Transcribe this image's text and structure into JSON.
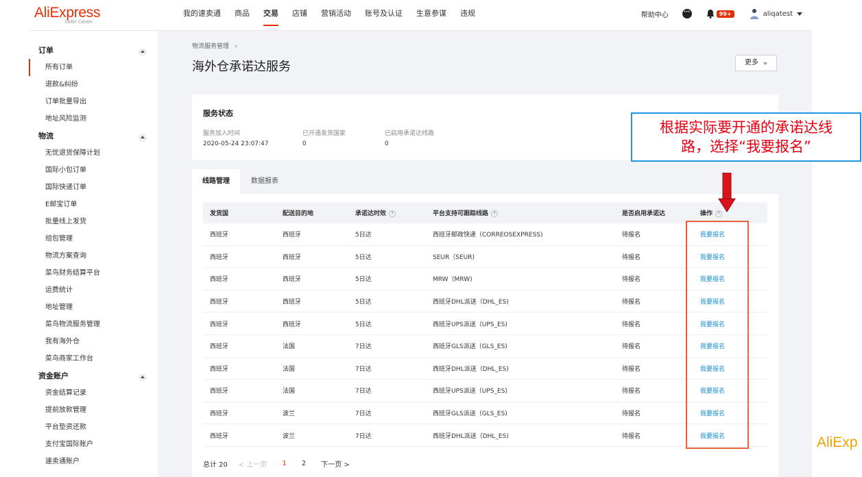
{
  "logo": {
    "brand": "AliExpress",
    "sub": "Seller Center"
  },
  "nav": {
    "items": [
      "我的速卖通",
      "商品",
      "交易",
      "店铺",
      "营销活动",
      "账号及认证",
      "生意参谋",
      "违规"
    ],
    "active_index": 2
  },
  "topbar": {
    "help": "帮助中心",
    "badge": "99+",
    "user": "aliqatest"
  },
  "sidebar": {
    "groups": [
      {
        "title": "订单",
        "items": [
          "所有订单",
          "退款&纠纷",
          "订单批量导出",
          "地址风险监测"
        ]
      },
      {
        "title": "物流",
        "items": [
          "无忧退货保障计划",
          "国际小包订单",
          "国际快递订单",
          "E邮宝订单",
          "批量线上发货",
          "组包管理",
          "物流方案查询",
          "菜鸟财务结算平台",
          "运费统计",
          "地址管理",
          "菜鸟物流服务管理",
          "我有海外仓",
          "菜鸟商家工作台"
        ]
      },
      {
        "title": "资金账户",
        "items": [
          "资金结算记录",
          "提前放款管理",
          "平台垫资还款",
          "支付宝国际账户",
          "速卖通账户"
        ]
      }
    ],
    "active_item": "所有订单"
  },
  "page": {
    "breadcrumb": "物流服务管理",
    "title": "海外仓承诺达服务",
    "more_button": "更多"
  },
  "status": {
    "title": "服务状态",
    "stats": [
      {
        "label": "服务加入时间",
        "value": "2020-05-24 23:07:47"
      },
      {
        "label": "已开通发货国家",
        "value": "0"
      },
      {
        "label": "已启用承诺达线路",
        "value": "0"
      }
    ]
  },
  "tabs": [
    "线路管理",
    "数据报表"
  ],
  "table": {
    "headers": [
      "发货国",
      "配送目的地",
      "承诺达时效",
      "平台支持可跟踪线路",
      "是否启用承诺达",
      "操作"
    ],
    "rows": [
      [
        "西班牙",
        "西班牙",
        "5日达",
        "西班牙邮政快递（CORREOSEXPRESS)",
        "待报名",
        "我要报名"
      ],
      [
        "西班牙",
        "西班牙",
        "5日达",
        "SEUR（SEUR)",
        "待报名",
        "我要报名"
      ],
      [
        "西班牙",
        "西班牙",
        "5日达",
        "MRW（MRW)",
        "待报名",
        "我要报名"
      ],
      [
        "西班牙",
        "西班牙",
        "5日达",
        "西班牙DHL派送（DHL_ES)",
        "待报名",
        "我要报名"
      ],
      [
        "西班牙",
        "西班牙",
        "5日达",
        "西班牙UPS派送（UPS_ES)",
        "待报名",
        "我要报名"
      ],
      [
        "西班牙",
        "法国",
        "7日达",
        "西班牙GLS派送（GLS_ES)",
        "待报名",
        "我要报名"
      ],
      [
        "西班牙",
        "法国",
        "7日达",
        "西班牙DHL派送（DHL_ES)",
        "待报名",
        "我要报名"
      ],
      [
        "西班牙",
        "法国",
        "7日达",
        "西班牙UPS派送（UPS_ES)",
        "待报名",
        "我要报名"
      ],
      [
        "西班牙",
        "波兰",
        "7日达",
        "西班牙GLS派送（GLS_ES)",
        "待报名",
        "我要报名"
      ],
      [
        "西班牙",
        "波兰",
        "7日达",
        "西班牙DHL派送（DHL_ES)",
        "待报名",
        "我要报名"
      ]
    ]
  },
  "pagination": {
    "total": "总计 20",
    "prev": "< 上一页",
    "pages": [
      "1",
      "2"
    ],
    "current": "1",
    "next": "下一页 >"
  },
  "annotation": {
    "line1": "根据实际要开通的承诺达线",
    "line2": "路，选择“我要报名”"
  },
  "right_logo": "AliExp",
  "colors": {
    "brand_red": "#e62e04",
    "link_blue": "#1890d5",
    "annotation_red": "#e60012",
    "callout_border": "#1f95e0",
    "highlight_orange": "#e8633a"
  }
}
